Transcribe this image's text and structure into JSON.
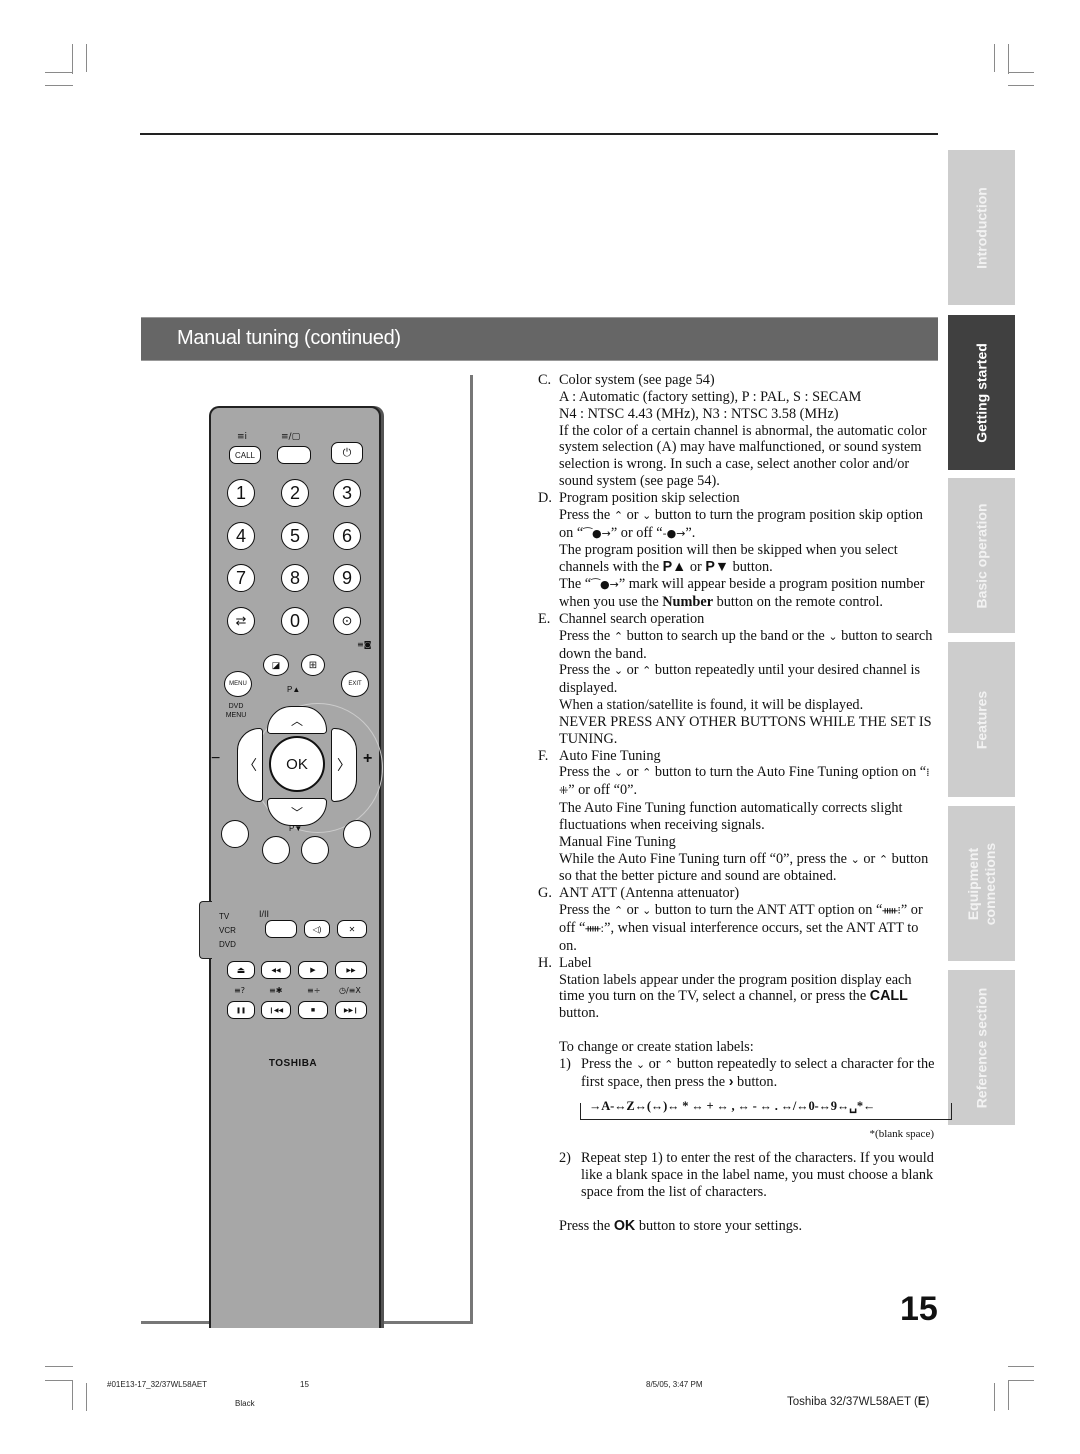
{
  "section_title": "Manual tuning (continued)",
  "side_tabs": [
    {
      "label": "Introduction",
      "active": false
    },
    {
      "label": "Getting started",
      "active": true
    },
    {
      "label": "Basic operation",
      "active": false
    },
    {
      "label": "Features",
      "active": false
    },
    {
      "label": "Equipment connections",
      "line1": "Equipment",
      "line2": "connections",
      "active": false
    },
    {
      "label": "Reference section",
      "active": false
    }
  ],
  "remote": {
    "call_label": "CALL",
    "numbers": [
      "1",
      "2",
      "3",
      "4",
      "5",
      "6",
      "7",
      "8",
      "9",
      "0"
    ],
    "menu_label": "MENU",
    "exit_label": "EXIT",
    "p_up_label": "P▲",
    "p_down_label": "P▼",
    "dvd_menu_label": "DVD MENU",
    "ok_label": "OK",
    "vol_minus": "−",
    "vol_plus": "+",
    "mode_tv": "TV",
    "mode_vcr": "VCR",
    "mode_dvd": "DVD",
    "dual_label": "I/II",
    "brand": "TOSHIBA",
    "icons": {
      "info": "≡i",
      "text_tv": "≡/▢",
      "power": "⏻",
      "swap": "⇄",
      "input": "⊙",
      "pip": "≡◙",
      "picture_size": "⊞",
      "picture_mode": "◪",
      "eject": "⏏",
      "rewind": "◀◀",
      "play": "▶",
      "ffwd": "▶▶",
      "pause": "❚❚",
      "prev": "❙◀◀",
      "stop": "■",
      "next": "▶▶❙",
      "sound": "◁)",
      "mute": "✕",
      "reveal": "≡?",
      "hold": "≡✱",
      "size": "≡÷",
      "timer": "◷/≡X"
    }
  },
  "content": {
    "C": {
      "marker": "C.",
      "title": "Color system (see page 54)",
      "lines": [
        "A : Automatic (factory setting), P : PAL, S : SECAM",
        "N4 : NTSC 4.43 (MHz), N3 : NTSC 3.58 (MHz)",
        "If the color of a certain channel is abnormal, the automatic color system selection (A) may have malfunctioned, or sound system selection is wrong. In such a case, select another color and/or sound system (see page 54)."
      ]
    },
    "D": {
      "marker": "D.",
      "title": "Program position skip selection",
      "l1a": "Press the ",
      "l1b": " or ",
      "l1c": " button to turn the program position skip option on “",
      "l1d": "” or off “",
      "l1e": "”.",
      "l2a": "The program position will then be skipped when you select channels with the ",
      "pup": "P▲",
      "l2b": " or ",
      "pdn": "P▼",
      "l2c": "  button.",
      "l3a": "The “",
      "l3b": "” mark will appear beside a program position number when you use the ",
      "number_bold": "Number",
      "l3c": " button on the remote control."
    },
    "E": {
      "marker": "E.",
      "title": "Channel search operation",
      "l1a": "Press the ",
      "l1b": " button to search up the band or the ",
      "l1c": " button to search down the band.",
      "l2a": "Press the ",
      "l2b": " or ",
      "l2c": " button repeatedly until your desired channel is displayed.",
      "l3": "When a station/satellite is found, it will be displayed.",
      "l4": "NEVER PRESS ANY OTHER BUTTONS WHILE THE SET IS TUNING."
    },
    "F": {
      "marker": "F.",
      "title": "Auto Fine Tuning",
      "l1a": "Press the ",
      "l1b": " or ",
      "l1c": " button to turn the Auto Fine Tuning option on “",
      "on_glyph": "⁞⁜",
      "l1d": "” or off “0”.",
      "l2": "The Auto Fine Tuning function automatically corrects slight fluctuations when receiving signals.",
      "l3": "Manual Fine Tuning",
      "l4a": "While the Auto Fine Tuning turn off “0”, press the ",
      "l4b": " or ",
      "l4c": " button so that the better picture and sound are obtained."
    },
    "G": {
      "marker": "G.",
      "title": "ANT ATT (Antenna attenuator)",
      "l1a": "Press the ",
      "l1b": " or ",
      "l1c": " button to turn the ANT ATT option on “",
      "on_glyph": "ᚔ⁝",
      "l1d": "” or off “",
      "off_glyph": "ᚔ:",
      "l1e": "”, when visual interference occurs, set the ANT ATT to on."
    },
    "H": {
      "marker": "H.",
      "title": "Label",
      "l1a": "Station labels appear under the program position display each time you turn on the TV, select a channel, or press the ",
      "call_bold": "CALL",
      "l1b": " button.",
      "intro": "To change or create station labels:",
      "step1_marker": "1)",
      "step1a": "Press the ",
      "step1b": " or ",
      "step1c": " button repeatedly to select a character for the first space, then press the ",
      "step1d": " button.",
      "char_sequence": "→A-↔Z↔(↔)↔ * ↔ + ↔ , ↔ - ↔ . ↔/↔0-↔9↔␣*←",
      "blank_note": "*(blank space)",
      "step2_marker": "2)",
      "step2": "Repeat step 1) to enter the rest of the characters. If you would like a blank space in the label name, you must choose a blank space from the list of characters.",
      "store_a": "Press the ",
      "ok_bold": "OK",
      "store_b": " button to store your settings."
    },
    "glyphs": {
      "up": "⌃",
      "down": "⌄",
      "right": "›",
      "skip_on": "⁀●→",
      "skip_off": "-●→"
    }
  },
  "page_number": "15",
  "footer": {
    "file": "#01E13-17_32/37WL58AET",
    "page": "15",
    "timestamp": "8/5/05, 3:47 PM",
    "color": "Black",
    "model_prefix": "Toshiba 32/37WL58AET (",
    "model_lang": "E",
    "model_suffix": ")"
  }
}
